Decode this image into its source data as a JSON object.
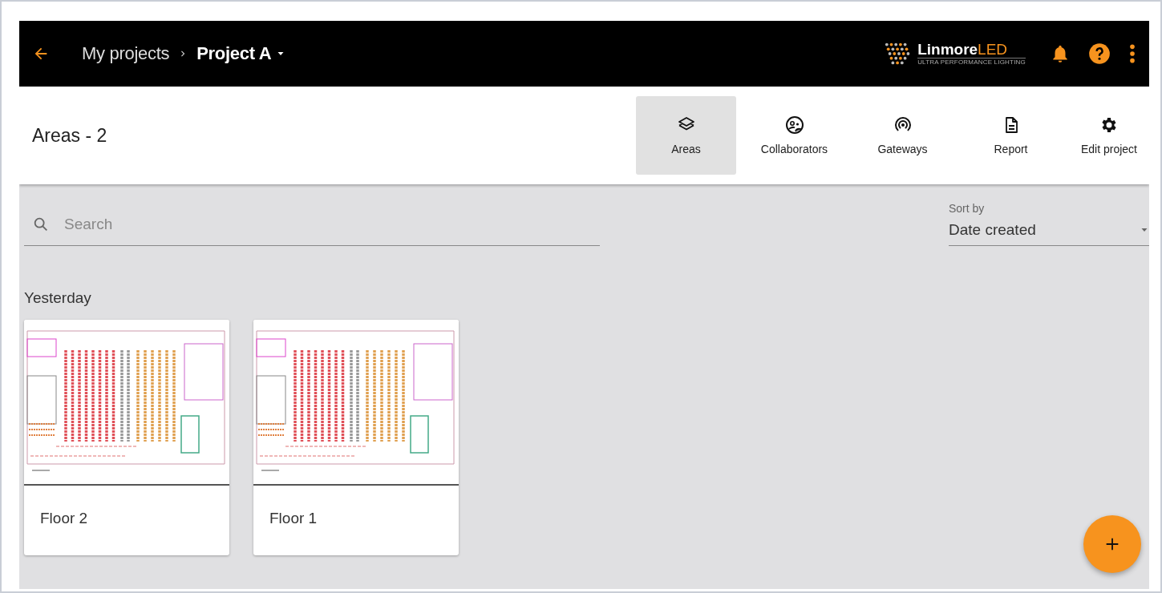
{
  "top_bar": {
    "breadcrumb": [
      {
        "label": "My projects",
        "current": false
      },
      {
        "label": "Project A",
        "current": true
      }
    ],
    "logo": {
      "name": "Linmore",
      "accent": "LED",
      "tagline": "ULTRA PERFORMANCE LIGHTING"
    }
  },
  "header": {
    "title": "Areas - 2",
    "tabs": [
      {
        "label": "Areas",
        "selected": true
      },
      {
        "label": "Collaborators",
        "selected": false
      },
      {
        "label": "Gateways",
        "selected": false
      },
      {
        "label": "Report",
        "selected": false
      },
      {
        "label": "Edit project",
        "selected": false
      }
    ]
  },
  "search": {
    "placeholder": "Search"
  },
  "sort": {
    "label": "Sort by",
    "value": "Date created"
  },
  "groups": [
    {
      "heading": "Yesterday",
      "cards": [
        {
          "title": "Floor 2"
        },
        {
          "title": "Floor 1"
        }
      ]
    }
  ]
}
